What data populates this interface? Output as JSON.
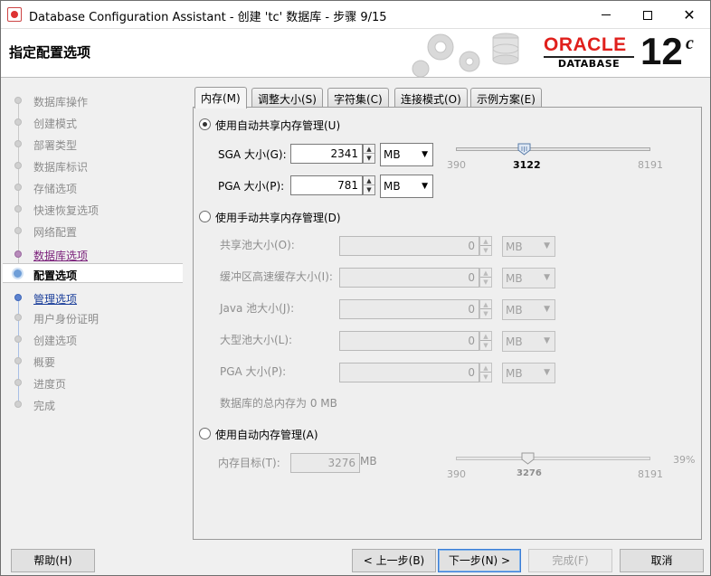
{
  "window": {
    "title": "Database Configuration Assistant - 创建 'tc' 数据库 - 步骤 9/15"
  },
  "header": {
    "title": "指定配置选项",
    "logo_oracle": "ORACLE",
    "logo_database": "DATABASE",
    "logo_version": "12",
    "logo_version_suffix": "c",
    "oracle_red": "#e0201c"
  },
  "steps": [
    {
      "label": "数据库操作",
      "state": "disabled"
    },
    {
      "label": "创建模式",
      "state": "disabled"
    },
    {
      "label": "部署类型",
      "state": "disabled"
    },
    {
      "label": "数据库标识",
      "state": "disabled"
    },
    {
      "label": "存储选项",
      "state": "disabled"
    },
    {
      "label": "快速恢复选项",
      "state": "disabled"
    },
    {
      "label": "网络配置",
      "state": "disabled"
    },
    {
      "label": "数据库选项",
      "state": "visited"
    },
    {
      "label": "配置选项",
      "state": "current"
    },
    {
      "label": "管理选项",
      "state": "link"
    },
    {
      "label": "用户身份证明",
      "state": "disabled"
    },
    {
      "label": "创建选项",
      "state": "disabled"
    },
    {
      "label": "概要",
      "state": "disabled"
    },
    {
      "label": "进度页",
      "state": "disabled"
    },
    {
      "label": "完成",
      "state": "disabled"
    }
  ],
  "tabs": [
    {
      "label": "内存(M)",
      "active": true
    },
    {
      "label": "调整大小(S)",
      "active": false
    },
    {
      "label": "字符集(C)",
      "active": false
    },
    {
      "label": "连接模式(O)",
      "active": false
    },
    {
      "label": "示例方案(E)",
      "active": false
    }
  ],
  "memory": {
    "auto_shared": {
      "label": "使用自动共享内存管理(U)",
      "selected": true,
      "sga_label": "SGA 大小(G):",
      "sga_value": "2341",
      "sga_unit": "MB",
      "pga_label": "PGA 大小(P):",
      "pga_value": "781",
      "pga_unit": "MB",
      "slider": {
        "min": "390",
        "max": "8191",
        "value": "3122"
      }
    },
    "manual_shared": {
      "label": "使用手动共享内存管理(D)",
      "selected": false,
      "fields": [
        {
          "label": "共享池大小(O):",
          "value": "0",
          "unit": "MB"
        },
        {
          "label": "缓冲区高速缓存大小(I):",
          "value": "0",
          "unit": "MB"
        },
        {
          "label": "Java 池大小(J):",
          "value": "0",
          "unit": "MB"
        },
        {
          "label": "大型池大小(L):",
          "value": "0",
          "unit": "MB"
        },
        {
          "label": "PGA 大小(P):",
          "value": "0",
          "unit": "MB"
        }
      ],
      "total_text": "数据库的总内存为 0 MB"
    },
    "auto_memory": {
      "label": "使用自动内存管理(A)",
      "selected": false,
      "target_label": "内存目标(T):",
      "target_value": "3276",
      "target_unit": "MB",
      "slider": {
        "min": "390",
        "max": "8191",
        "value": "3276"
      },
      "percent": "39%"
    }
  },
  "buttons": {
    "help": "帮助(H)",
    "back": "< 上一步(B)",
    "next": "下一步(N) >",
    "finish": "完成(F)",
    "cancel": "取消"
  }
}
